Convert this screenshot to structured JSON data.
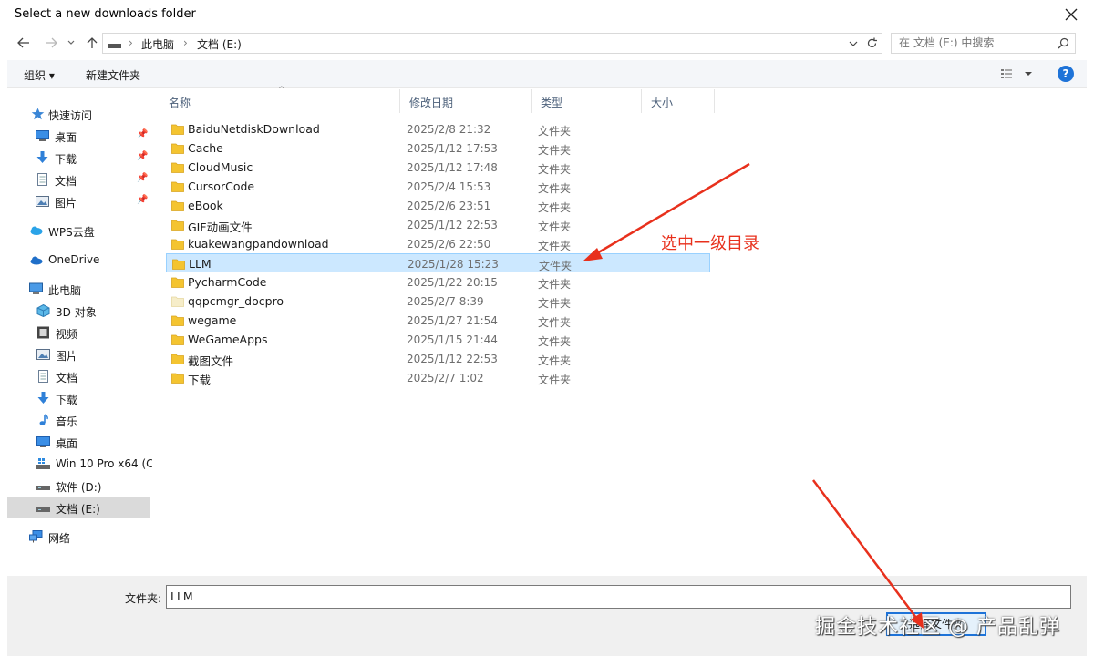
{
  "window": {
    "title": "Select a new downloads folder"
  },
  "address": {
    "crumbs": [
      "此电脑",
      "文档 (E:)"
    ]
  },
  "search": {
    "placeholder": "在 文档 (E:) 中搜索"
  },
  "toolbar": {
    "organize": "组织 ▾",
    "new_folder": "新建文件夹",
    "help": "?"
  },
  "sidebar": {
    "items": [
      {
        "label": "快速访问",
        "icon": "star-icon",
        "pinned": false
      },
      {
        "label": "桌面",
        "icon": "desktop-icon",
        "pinned": true
      },
      {
        "label": "下载",
        "icon": "download-icon",
        "pinned": true
      },
      {
        "label": "文档",
        "icon": "document-icon",
        "pinned": true
      },
      {
        "label": "图片",
        "icon": "picture-icon",
        "pinned": true
      },
      {
        "label": "WPS云盘",
        "icon": "cloud-icon",
        "pinned": false
      },
      {
        "label": "OneDrive",
        "icon": "onedrive-icon",
        "pinned": false
      },
      {
        "label": "此电脑",
        "icon": "computer-icon",
        "pinned": false
      },
      {
        "label": "3D 对象",
        "icon": "3d-objects-icon",
        "pinned": false
      },
      {
        "label": "视频",
        "icon": "video-icon",
        "pinned": false
      },
      {
        "label": "图片",
        "icon": "picture-icon",
        "pinned": false
      },
      {
        "label": "文档",
        "icon": "document-icon",
        "pinned": false
      },
      {
        "label": "下载",
        "icon": "download-icon",
        "pinned": false
      },
      {
        "label": "音乐",
        "icon": "music-icon",
        "pinned": false
      },
      {
        "label": "桌面",
        "icon": "desktop-icon",
        "pinned": false
      },
      {
        "label": "Win 10 Pro x64 (C",
        "icon": "windows-drive-icon",
        "pinned": false
      },
      {
        "label": "软件 (D:)",
        "icon": "drive-icon",
        "pinned": false
      },
      {
        "label": "文档 (E:)",
        "icon": "drive-icon",
        "pinned": false,
        "selected": true
      },
      {
        "label": "网络",
        "icon": "network-icon",
        "pinned": false
      }
    ]
  },
  "columns": {
    "name": "名称",
    "modified": "修改日期",
    "type": "类型",
    "size": "大小"
  },
  "files": [
    {
      "name": "BaiduNetdiskDownload",
      "date": "2025/2/8 21:32",
      "type": "文件夹"
    },
    {
      "name": "Cache",
      "date": "2025/1/12 17:53",
      "type": "文件夹"
    },
    {
      "name": "CloudMusic",
      "date": "2025/1/12 17:48",
      "type": "文件夹"
    },
    {
      "name": "CursorCode",
      "date": "2025/2/4 15:53",
      "type": "文件夹"
    },
    {
      "name": "eBook",
      "date": "2025/2/6 23:51",
      "type": "文件夹"
    },
    {
      "name": "GIF动画文件",
      "date": "2025/1/12 22:53",
      "type": "文件夹"
    },
    {
      "name": "kuakewangpandownload",
      "date": "2025/2/6 22:50",
      "type": "文件夹"
    },
    {
      "name": "LLM",
      "date": "2025/1/28 15:23",
      "type": "文件夹",
      "selected": true
    },
    {
      "name": "PycharmCode",
      "date": "2025/1/22 20:15",
      "type": "文件夹"
    },
    {
      "name": "qqpcmgr_docpro",
      "date": "2025/2/7 8:39",
      "type": "文件夹",
      "hidden": true
    },
    {
      "name": "wegame",
      "date": "2025/1/27 21:54",
      "type": "文件夹"
    },
    {
      "name": "WeGameApps",
      "date": "2025/1/15 21:44",
      "type": "文件夹"
    },
    {
      "name": "截图文件",
      "date": "2025/1/12 22:53",
      "type": "文件夹"
    },
    {
      "name": "下载",
      "date": "2025/2/7 1:02",
      "type": "文件夹"
    }
  ],
  "annotation": {
    "text": "选中一级目录"
  },
  "footer": {
    "folder_label": "文件夹:",
    "folder_value": "LLM",
    "select_button": "选择文件夹"
  },
  "watermark": {
    "text": "掘金技术社区 @ 产品乱弹"
  },
  "colors": {
    "accent": "#1e73d8",
    "selection": "#cce8ff",
    "annotation": "#e8301c"
  }
}
